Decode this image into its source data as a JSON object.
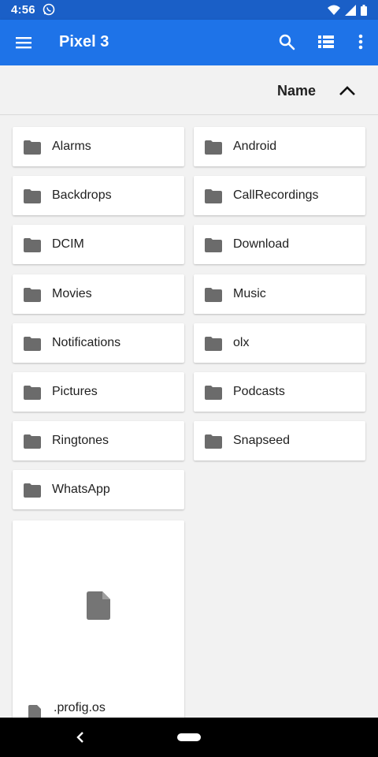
{
  "status_bar": {
    "time": "4:56",
    "icons": [
      "whatsapp-icon",
      "wifi-icon",
      "signal-icon",
      "battery-icon"
    ]
  },
  "app_bar": {
    "title": "Pixel 3",
    "color": "#1e73e8",
    "icons": [
      "menu-icon",
      "search-icon",
      "list-view-icon",
      "more-vert-icon"
    ]
  },
  "sort_bar": {
    "label": "Name",
    "direction_icon": "chevron-up-icon"
  },
  "folders": [
    {
      "label": "Alarms"
    },
    {
      "label": "Android"
    },
    {
      "label": "Backdrops"
    },
    {
      "label": "CallRecordings"
    },
    {
      "label": "DCIM"
    },
    {
      "label": "Download"
    },
    {
      "label": "Movies"
    },
    {
      "label": "Music"
    },
    {
      "label": "Notifications"
    },
    {
      "label": "olx"
    },
    {
      "label": "Pictures"
    },
    {
      "label": "Podcasts"
    },
    {
      "label": "Ringtones"
    },
    {
      "label": "Snapseed"
    },
    {
      "label": "WhatsApp"
    }
  ],
  "files": [
    {
      "label": ".profig.os",
      "icon": "file-icon"
    }
  ],
  "nav_bar": {
    "icons": [
      "back-icon",
      "home-pill"
    ]
  }
}
